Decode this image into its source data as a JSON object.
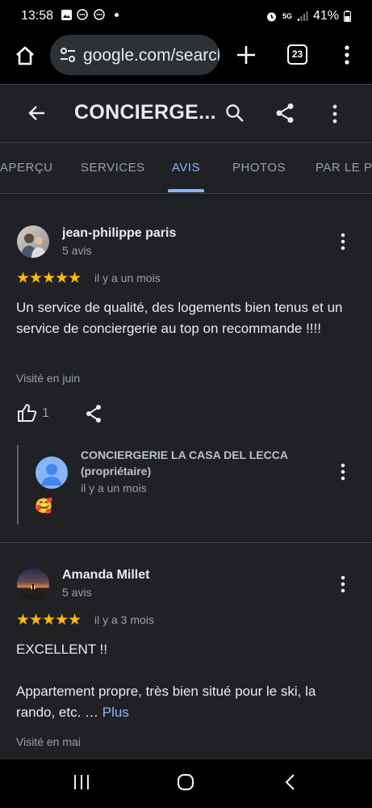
{
  "status": {
    "time": "13:58",
    "battery": "41%",
    "network": "5G"
  },
  "browser": {
    "url": "google.com/search",
    "tab_count": "23"
  },
  "header": {
    "title": "CONCIERGE..."
  },
  "tabs": [
    "APERÇU",
    "SERVICES",
    "AVIS",
    "PHOTOS",
    "PAR LE PR"
  ],
  "active_tab": "AVIS",
  "reviews": [
    {
      "name": "jean-philippe paris",
      "count": "5 avis",
      "rating": 5,
      "stars": "★★★★★",
      "date": "il y a un mois",
      "text": "Un service de qualité, des logements bien tenus et un service de conciergerie au top on recommande !!!!",
      "visited": "Visité en juin",
      "likes": "1",
      "owner_reply": {
        "name": "CONCIERGERIE LA CASA DEL LECCA",
        "role": "(propriétaire)",
        "date": "il y a un mois",
        "emoji": "🥰"
      }
    },
    {
      "name": "Amanda Millet",
      "count": "5 avis",
      "rating": 5,
      "stars": "★★★★★",
      "date": "il y a 3 mois",
      "text_line1": "EXCELLENT !!",
      "text_line2": "Appartement propre, très bien situé pour le ski, la rando, etc. …",
      "more_link": "Plus",
      "visited": "Visité en mai"
    }
  ],
  "colors": {
    "accent": "#8ab4f8",
    "star": "#fbbc04",
    "background": "#202124"
  }
}
